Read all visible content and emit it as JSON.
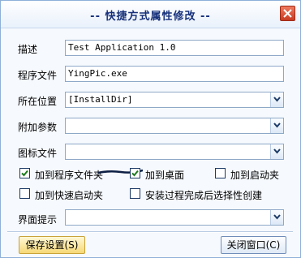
{
  "window": {
    "title": "-- 快捷方式属性修改 --"
  },
  "fields": {
    "description": {
      "label": "描述",
      "value": "Test Application 1.0"
    },
    "program_file": {
      "label": "程序文件",
      "value": "YingPic.exe"
    },
    "location": {
      "label": "所在位置",
      "value": "[InstallDir]"
    },
    "extra_params": {
      "label": "附加参数",
      "value": ""
    },
    "icon_file": {
      "label": "图标文件",
      "value": ""
    },
    "ui_hint": {
      "label": "界面提示",
      "value": ""
    }
  },
  "checkboxes": {
    "add_to_programs": {
      "label": "加到程序文件夹",
      "checked": true
    },
    "add_to_desktop": {
      "label": "加到桌面",
      "checked": true
    },
    "add_to_startup": {
      "label": "加到启动夹",
      "checked": false
    },
    "add_to_quicklaunch": {
      "label": "加到快速启动夹",
      "checked": false
    },
    "optional_create": {
      "label": "安装过程完成后选择性创建",
      "checked": false
    }
  },
  "buttons": {
    "save": "保存设置(S)",
    "close": "关闭窗口(C)"
  },
  "colors": {
    "title": "#16307a",
    "close_button": "#d4492f",
    "save_button": "#f6d877"
  }
}
